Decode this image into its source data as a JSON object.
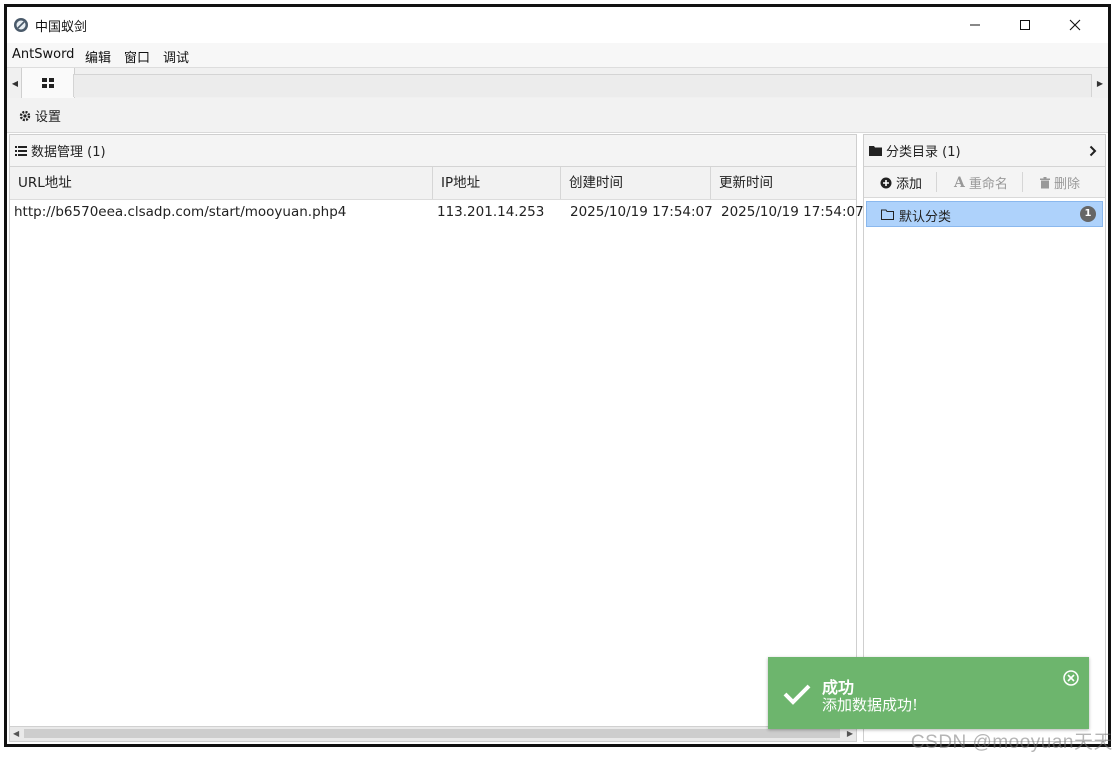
{
  "window": {
    "title": "中国蚁剑",
    "controls": [
      "minimize-icon",
      "maximize-icon",
      "close-icon"
    ]
  },
  "menu": [
    {
      "label": "AntSword"
    },
    {
      "label": "编辑"
    },
    {
      "label": "窗口"
    },
    {
      "label": "调试"
    }
  ],
  "toolbar": {
    "settings_label": "设置"
  },
  "data_panel": {
    "title": "数据管理 (1)",
    "columns": [
      "URL地址",
      "IP地址",
      "创建时间",
      "更新时间"
    ],
    "rows": [
      {
        "url": "http://b6570eea.clsadp.com/start/mooyuan.php4",
        "ip": "113.201.14.253",
        "created": "2025/10/19 17:54:07",
        "updated": "2025/10/19 17:54:07"
      }
    ]
  },
  "category_panel": {
    "title": "分类目录 (1)",
    "add_label": "添加",
    "rename_label": "重命名",
    "delete_label": "删除",
    "items": [
      {
        "label": "默认分类",
        "count": "1"
      }
    ]
  },
  "toast": {
    "title": "成功",
    "message": "添加数据成功!",
    "color": "#6db56d"
  },
  "watermark": "CSDN @mooyuan天天",
  "colors": {
    "selection": "#aed2fb",
    "toast_bg": "#6db56d"
  }
}
